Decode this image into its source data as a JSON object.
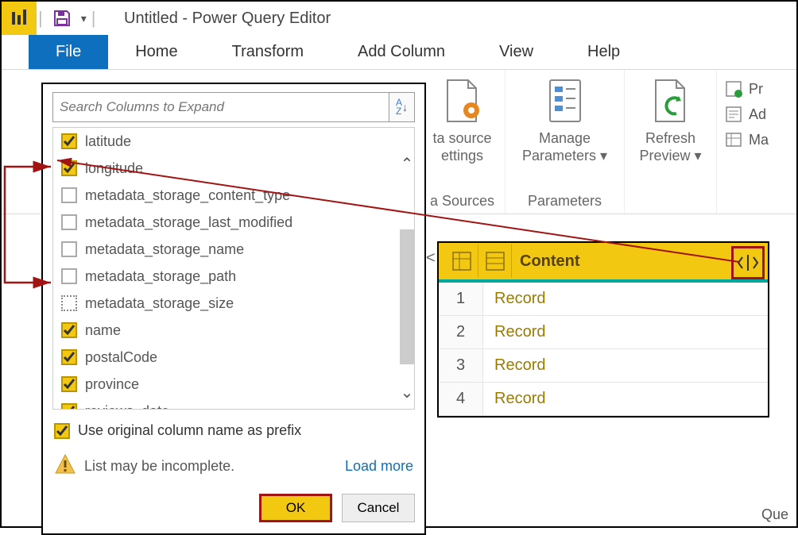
{
  "title_bar": {
    "title": "Untitled - Power Query Editor",
    "separator": " | "
  },
  "tabs": [
    "File",
    "Home",
    "Transform",
    "Add Column",
    "View",
    "Help"
  ],
  "ribbon": {
    "data_source": {
      "line1": "ta source",
      "line2": "ettings",
      "group_footer": "a Sources"
    },
    "parameters": {
      "line1": "Manage",
      "line2": "Parameters ▾",
      "group_footer": "Parameters"
    },
    "refresh": {
      "line1": "Refresh",
      "line2": "Preview ▾"
    },
    "right_items": [
      "Pr",
      "Ad",
      "Ma"
    ],
    "right_footer": "Que"
  },
  "grid": {
    "column_header": "Content",
    "rows": [
      {
        "n": "1",
        "val": "Record"
      },
      {
        "n": "2",
        "val": "Record"
      },
      {
        "n": "3",
        "val": "Record"
      },
      {
        "n": "4",
        "val": "Record"
      }
    ]
  },
  "popup": {
    "search_placeholder": "Search Columns to Expand",
    "columns": [
      {
        "label": "latitude",
        "state": "checked"
      },
      {
        "label": "longitude",
        "state": "checked"
      },
      {
        "label": "metadata_storage_content_type",
        "state": "unchecked"
      },
      {
        "label": "metadata_storage_last_modified",
        "state": "unchecked"
      },
      {
        "label": "metadata_storage_name",
        "state": "unchecked"
      },
      {
        "label": "metadata_storage_path",
        "state": "unchecked"
      },
      {
        "label": "metadata_storage_size",
        "state": "dotted"
      },
      {
        "label": "name",
        "state": "checked"
      },
      {
        "label": "postalCode",
        "state": "checked"
      },
      {
        "label": "province",
        "state": "checked"
      },
      {
        "label": "reviews_date",
        "state": "checked"
      }
    ],
    "prefix_label": "Use original column name as prefix",
    "warning": "List may be incomplete.",
    "load_more": "Load more",
    "ok": "OK",
    "cancel": "Cancel"
  }
}
